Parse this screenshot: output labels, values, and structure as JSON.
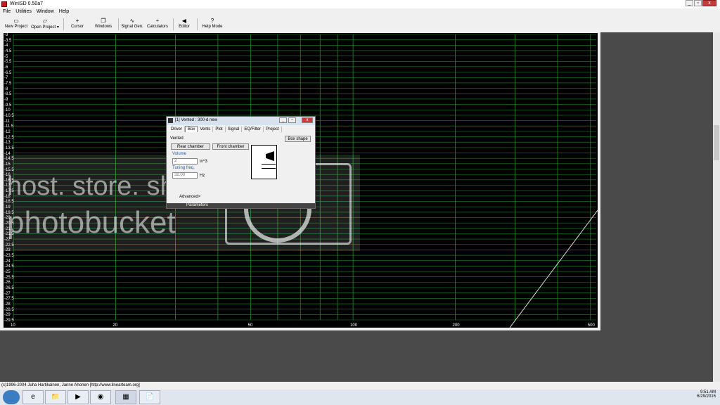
{
  "window": {
    "title": "WinISD 0.50a7",
    "controls": [
      "_",
      "▫",
      "x"
    ]
  },
  "menu": [
    "File",
    "Utilities",
    "Window",
    "Help"
  ],
  "toolbar": {
    "new_project": "New Project",
    "open_project": "Open Project",
    "cursor": "Cursor",
    "windows": "Windows",
    "signal_gen": "Signal Gen.",
    "calculators": "Calculators",
    "editor": "Editor",
    "help_mode": "Help Mode"
  },
  "graph": {
    "y_ticks": [
      "-3",
      "-3.5",
      "-4",
      "-4.5",
      "-5",
      "-5.5",
      "-6",
      "-6.5",
      "-7",
      "-7.5",
      "-8",
      "-8.5",
      "-9",
      "-9.5",
      "-10",
      "-10.5",
      "-11",
      "-11.5",
      "-12",
      "-12.5",
      "-13",
      "-13.5",
      "-14",
      "-14.5",
      "-15",
      "-15.5",
      "-16",
      "-16.5",
      "-17",
      "-17.5",
      "-18",
      "-18.5",
      "-19",
      "-19.5",
      "-20",
      "-20.5",
      "-21",
      "-21.5",
      "-22",
      "-22.5",
      "-23",
      "-23.5",
      "-24",
      "-24.5",
      "-25",
      "-25.5",
      "-26",
      "-26.5",
      "-27",
      "-27.5",
      "-28",
      "-28.5",
      "-29",
      "-29.5"
    ],
    "x_ticks": [
      "10",
      "20",
      "50",
      "100",
      "200",
      "500"
    ],
    "grid_color": "#1e8a2a",
    "trace_color": "#d8d8d8"
  },
  "dialog": {
    "title": "[1] Vented : 300-d new",
    "tabs": [
      "Driver",
      "Box",
      "Vents",
      "Plot",
      "Signal",
      "EQ/Filter",
      "Project"
    ],
    "active_tab": "Box",
    "type_label": "Vented",
    "box_shape_button": "Box shape",
    "rear_chamber": "Rear chamber",
    "front_chamber": "Front chamber",
    "volume_label": "Volume",
    "volume_value": "2",
    "volume_unit": "in^3",
    "tuning_label": "Tuning freq.",
    "tuning_value": "32.00",
    "tuning_unit": "Hz",
    "advanced": "Advanced>",
    "parameters": "Parameters"
  },
  "watermark": {
    "line1": "host. store. share.",
    "line2": "photobucket"
  },
  "status": "(c)1996-2004 Juha Hartikainen, Janne Ahonen [http://www.linearteam.org]",
  "taskbar": {
    "apps": [
      "e",
      "📁",
      "▶",
      "◉",
      "▦",
      "📄"
    ],
    "time": "9:51 AM",
    "date": "6/29/2015"
  }
}
